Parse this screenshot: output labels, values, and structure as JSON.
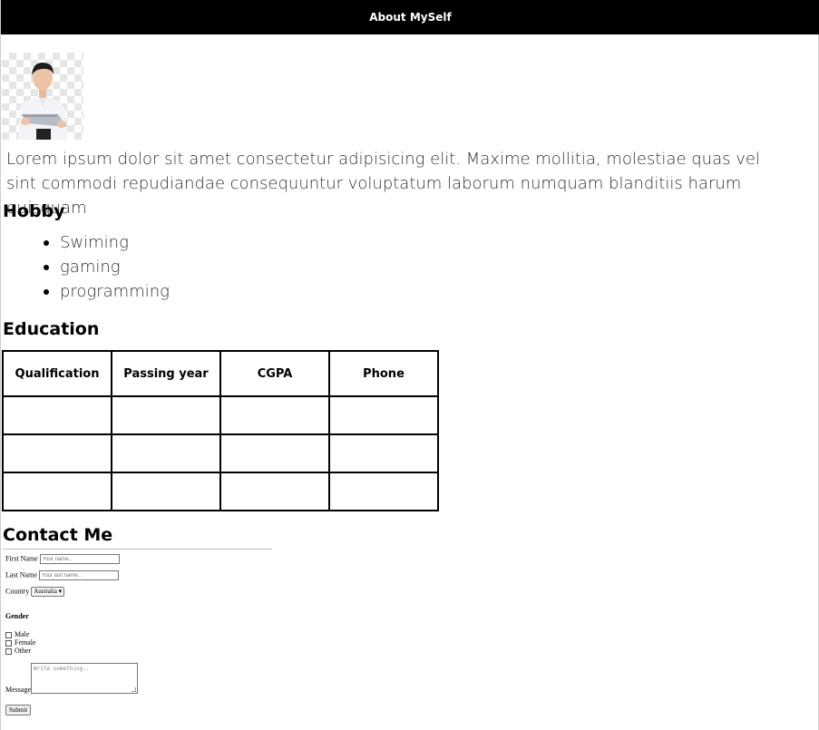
{
  "header": {
    "title": "About MySelf"
  },
  "intro": {
    "text": "Lorem ipsum dolor sit amet consectetur adipisicing elit. Maxime mollitia, molestiae quas vel sint commodi repudiandae consequuntur voluptatum laborum numquam blanditiis harum quisquam"
  },
  "hobby": {
    "title": "Hobby",
    "items": [
      "Swiming",
      "gaming",
      "programming"
    ]
  },
  "education": {
    "title": "Education",
    "headers": [
      "Qualification",
      "Passing year",
      "CGPA",
      "Phone"
    ]
  },
  "contact": {
    "title": "Contact Me",
    "first_name_label": "First Name",
    "first_name_placeholder": "Your name..",
    "last_name_label": "Last Name",
    "last_name_placeholder": "Your last name..",
    "country_label": "Country",
    "country_value": "Australia",
    "gender_label": "Gender",
    "gender_options": [
      "Male",
      "Female",
      "Other"
    ],
    "message_label": "Message",
    "message_placeholder": "Write something..",
    "submit_label": "Submit"
  }
}
